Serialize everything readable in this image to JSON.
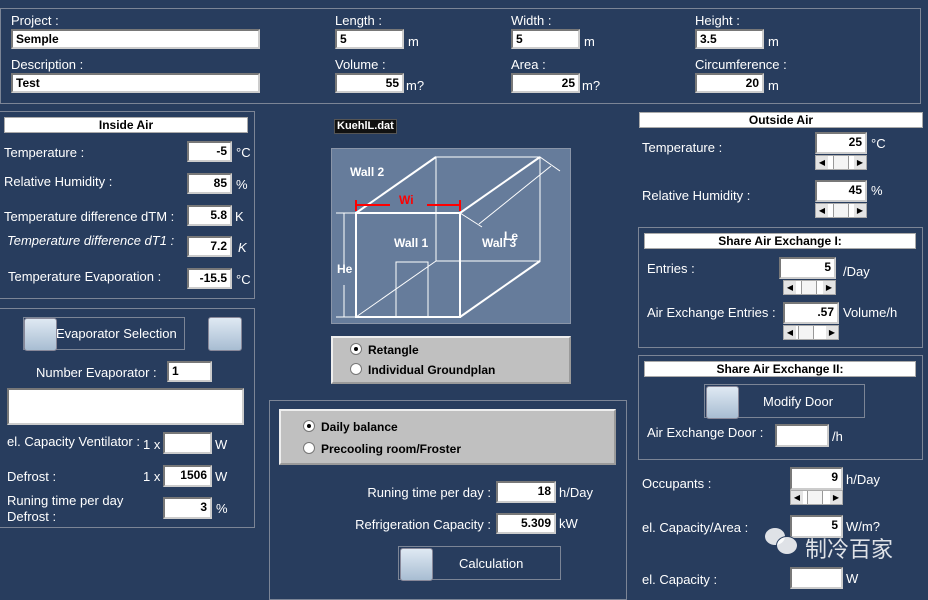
{
  "header": {
    "project_label": "Project :",
    "project": "Semple",
    "description_label": "Description :",
    "description": "Test",
    "length_label": "Length :",
    "length": "5",
    "length_unit": "m",
    "width_label": "Width :",
    "width": "5",
    "width_unit": "m",
    "height_label": "Height :",
    "height": "3.5",
    "height_unit": "m",
    "volume_label": "Volume :",
    "volume": "55",
    "volume_unit": "m?",
    "area_label": "Area :",
    "area": "25",
    "area_unit": "m?",
    "circ_label": "Circumference :",
    "circ": "20",
    "circ_unit": "m"
  },
  "inside": {
    "title": "Inside Air",
    "temp_label": "Temperature :",
    "temp": "-5",
    "temp_unit": "°C",
    "rh_label": "Relative Humidity :",
    "rh": "85",
    "rh_unit": "%",
    "dtm_label": "Temperature difference dTM :",
    "dtm": "5.8",
    "dtm_unit": "K",
    "dt1_label": "Temperature difference dT1 :",
    "dt1": "7.2",
    "dt1_unit": "K",
    "evap_label": "Temperature Evaporation :",
    "evap": "-15.5",
    "evap_unit": "°C"
  },
  "evaporator": {
    "select_label": "Evaporator Selection",
    "number_label": "Number Evaporator :",
    "number": "1",
    "description": "",
    "vent_label": "el. Capacity Ventilator :",
    "vent_mult": "1 x",
    "vent": "",
    "vent_unit": "W",
    "defrost_label": "Defrost :",
    "defrost_mult": "1 x",
    "defrost": "1506",
    "defrost_unit": "W",
    "run_label1": "Runing time per day",
    "run_label2": "Defrost :",
    "run": "3",
    "run_unit": "%"
  },
  "center": {
    "file": "KuehlL.dat",
    "diagram": {
      "wall1": "Wall 1",
      "wall2": "Wall 2",
      "wall3": "Wall 3",
      "wi": "Wi",
      "le": "Le",
      "he": "He"
    },
    "plan_options": [
      "Retangle",
      "Individual Groundplan"
    ],
    "plan_selected": 0,
    "balance_options": [
      "Daily balance",
      "Precooling room/Froster"
    ],
    "balance_selected": 0,
    "run_label": "Runing time per day :",
    "run": "18",
    "run_unit": "h/Day",
    "cap_label": "Refrigeration Capacity :",
    "cap": "5.309",
    "cap_unit": "kW",
    "calc_label": "Calculation"
  },
  "outside": {
    "title": "Outside Air",
    "temp_label": "Temperature :",
    "temp": "25",
    "temp_unit": "°C",
    "rh_label": "Relative Humidity :",
    "rh": "45",
    "rh_unit": "%"
  },
  "share1": {
    "title": "Share Air Exchange I:",
    "entries_label": "Entries :",
    "entries": "5",
    "entries_unit": "/Day",
    "aee_label": "Air Exchange Entries :",
    "aee": ".57",
    "aee_unit": "Volume/h"
  },
  "share2": {
    "title": "Share Air Exchange II:",
    "modify_label": "Modify Door",
    "door_label": "Air Exchange Door :",
    "door": "",
    "door_unit": "/h"
  },
  "other": {
    "occ_label": "Occupants :",
    "occ": "9",
    "occ_unit": "h/Day",
    "cap_area_label": "el. Capacity/Area :",
    "cap_area": "5",
    "cap_area_unit": "W/m?",
    "cap_label": "el. Capacity :",
    "cap": "",
    "cap_unit": "W"
  },
  "watermark": "制冷百家"
}
